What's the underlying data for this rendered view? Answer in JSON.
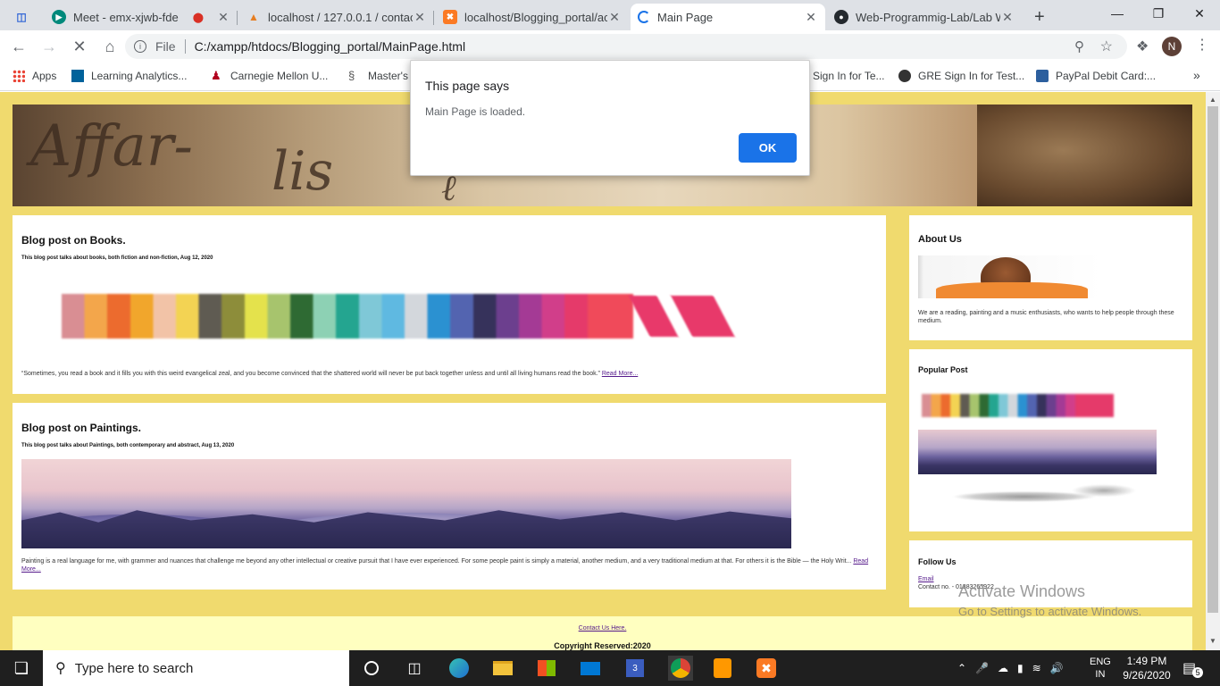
{
  "browser": {
    "tabs": [
      {
        "title": "Meet - emx-xjwb-fde",
        "icon": "meet-icon"
      },
      {
        "title": "localhost / 127.0.0.1 / contact",
        "icon": "phpmyadmin-icon"
      },
      {
        "title": "localhost/Blogging_portal/act",
        "icon": "xampp-icon"
      },
      {
        "title": "Main Page",
        "icon": "loading-icon",
        "active": true
      },
      {
        "title": "Web-Programmig-Lab/Lab W",
        "icon": "github-icon"
      }
    ],
    "url_prefix": "File",
    "url": "C:/xampp/htdocs/Blogging_portal/MainPage.html",
    "profile_initial": "N",
    "bookmarks": [
      {
        "label": "Apps"
      },
      {
        "label": "Learning Analytics..."
      },
      {
        "label": "Carnegie Mellon U..."
      },
      {
        "label": "Master's"
      },
      {
        "label": "Sign In for Te..."
      },
      {
        "label": "GRE Sign In for Test..."
      },
      {
        "label": "PayPal Debit Card:..."
      }
    ]
  },
  "page": {
    "posts": [
      {
        "title": "Blog post on Books.",
        "subtitle": "This blog post talks about books, both fiction and non-fiction, Aug 12, 2020",
        "text": "“Sometimes, you read a book and it fills you with this weird evangelical zeal, and you become convinced that the shattered world will never be put back together unless and until all living humans read the book.”",
        "read_more": "Read More..."
      },
      {
        "title": "Blog post on Paintings.",
        "subtitle": "This blog post talks about Paintings, both contemporary and abstract, Aug 13, 2020",
        "text": "Painting is a real language for me, with grammer and nuances that challenge me beyond any other intellectual or creative pursuit that I have ever experienced. For some people paint is simply a material, another medium, and a very traditional medium at that. For others it is the Bible — the Holy Writ...",
        "read_more": "Read More..."
      }
    ],
    "about": {
      "title": "About Us",
      "text": "We are a reading, painting and a music enthusiasts, who wants to help people through these medium."
    },
    "popular": {
      "title": "Popular Post"
    },
    "follow": {
      "title": "Follow Us",
      "email": "Email",
      "contact": "Contact no. - 01383265922"
    },
    "footer": {
      "contact_link": "Contact Us Here.",
      "copyright": "Copyright Reserved:2020"
    }
  },
  "dialog": {
    "title": "This page says",
    "message": "Main Page is loaded.",
    "ok_label": "OK"
  },
  "watermark": {
    "line1": "Activate Windows",
    "line2": "Go to Settings to activate Windows."
  },
  "taskbar": {
    "search_placeholder": "Type here to search",
    "lang1": "ENG",
    "lang2": "IN",
    "time": "1:49 PM",
    "date": "9/26/2020",
    "notification_count": "5"
  },
  "colors": {
    "page_bg": "#f0da6e",
    "footer_bg": "#ffffc0",
    "dialog_button": "#1a73e8"
  }
}
